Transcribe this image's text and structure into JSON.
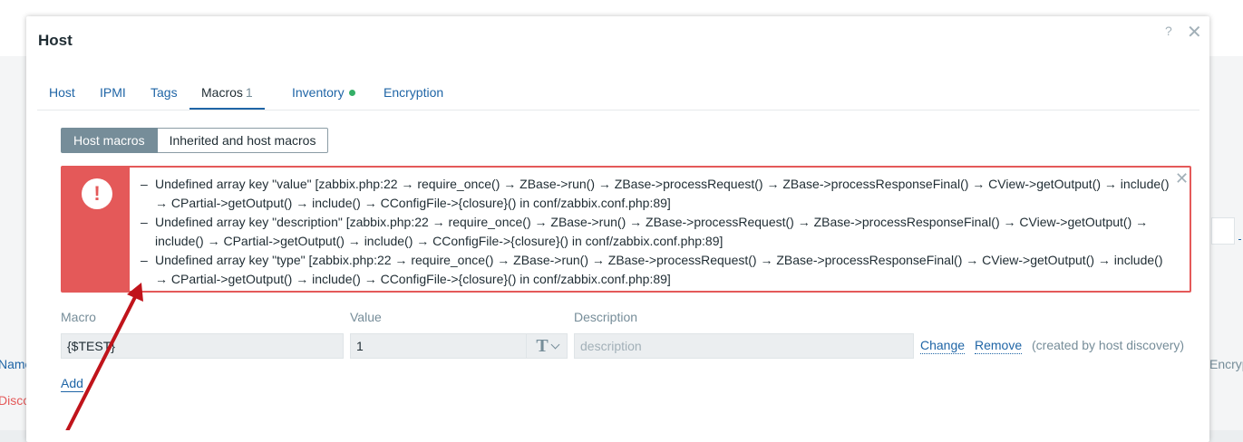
{
  "background": {
    "left_name_fragment": "Name",
    "left_disc_fragment": "Disco",
    "right_enc_fragment": "Encryption"
  },
  "dialog": {
    "title": "Host",
    "help": "?",
    "close": "✕"
  },
  "tabs": [
    {
      "label": "Host"
    },
    {
      "label": "IPMI"
    },
    {
      "label": "Tags"
    },
    {
      "label": "Macros",
      "count": "1",
      "active": true
    },
    {
      "label": "Inventory",
      "indicator_color": "#34af67"
    },
    {
      "label": "Encryption"
    }
  ],
  "macro_view": {
    "host_macros": "Host macros",
    "inherited_macros": "Inherited and host macros"
  },
  "error_box": {
    "icon": "!",
    "close": "✕",
    "messages": [
      "Undefined array key \"value\" [zabbix.php:22 → require_once() → ZBase->run() → ZBase->processRequest() → ZBase->processResponseFinal() → CView->getOutput() → include() → CPartial->getOutput() → include() → CConfigFile->{closure}() in conf/zabbix.conf.php:89]",
      "Undefined array key \"description\" [zabbix.php:22 → require_once() → ZBase->run() → ZBase->processRequest() → ZBase->processResponseFinal() → CView->getOutput() → include() → CPartial->getOutput() → include() → CConfigFile->{closure}() in conf/zabbix.conf.php:89]",
      "Undefined array key \"type\" [zabbix.php:22 → require_once() → ZBase->run() → ZBase->processRequest() → ZBase->processResponseFinal() → CView->getOutput() → include() → CPartial->getOutput() → include() → CConfigFile->{closure}() in conf/zabbix.conf.php:89]"
    ]
  },
  "table": {
    "headers": {
      "macro": "Macro",
      "value": "Value",
      "description": "Description"
    },
    "row": {
      "macro": "{$TEST}",
      "value": "1",
      "value_type_icon": "text-type-icon",
      "description_placeholder": "description",
      "change": "Change",
      "remove": "Remove",
      "note": "(created by host discovery)"
    },
    "add": "Add"
  },
  "colors": {
    "error": "#e45959",
    "link": "#1f65a6",
    "annotation_arrow": "#c0141b"
  }
}
